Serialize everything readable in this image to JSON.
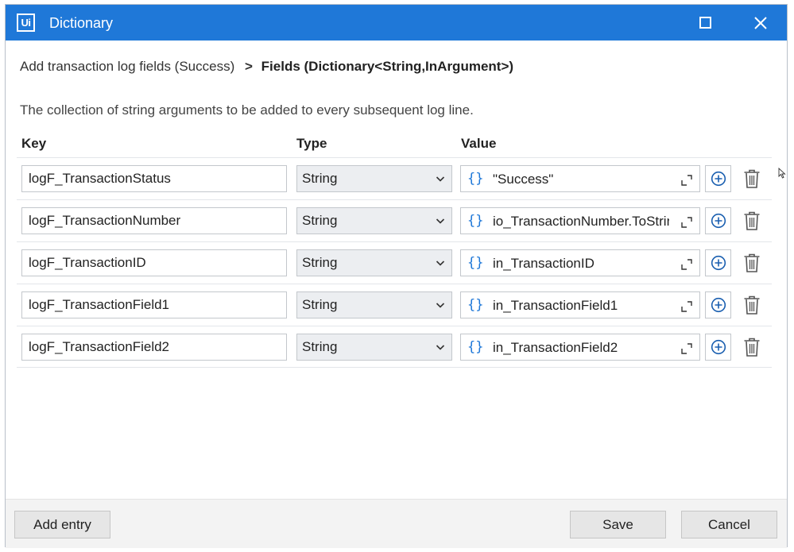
{
  "window": {
    "logo": "Ui",
    "title": "Dictionary"
  },
  "breadcrumb": {
    "parent": "Add transaction log fields (Success)",
    "separator": ">",
    "current": "Fields (Dictionary<String,InArgument>)"
  },
  "description": "The collection of string arguments to be added to every subsequent log line.",
  "columns": {
    "key": "Key",
    "type": "Type",
    "value": "Value"
  },
  "rows": [
    {
      "key": "logF_TransactionStatus",
      "type": "String",
      "value": "\"Success\""
    },
    {
      "key": "logF_TransactionNumber",
      "type": "String",
      "value": "io_TransactionNumber.ToString"
    },
    {
      "key": "logF_TransactionID",
      "type": "String",
      "value": "in_TransactionID"
    },
    {
      "key": "logF_TransactionField1",
      "type": "String",
      "value": "in_TransactionField1"
    },
    {
      "key": "logF_TransactionField2",
      "type": "String",
      "value": "in_TransactionField2"
    }
  ],
  "value_brace_glyph": "{}",
  "footer": {
    "add_entry": "Add entry",
    "save": "Save",
    "cancel": "Cancel"
  },
  "colors": {
    "titlebar": "#1f78d8",
    "accent": "#1f78d8"
  },
  "icons": [
    "maximize-icon",
    "close-icon",
    "chevron-down-icon",
    "expand-icon",
    "add-circle-icon",
    "trash-icon",
    "mouse-cursor-icon"
  ]
}
